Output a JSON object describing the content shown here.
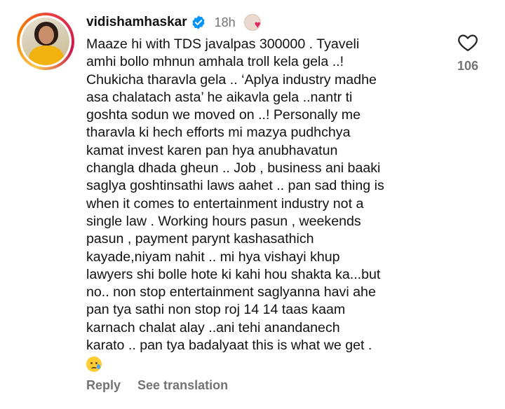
{
  "comment": {
    "username": "vidishamhaskar",
    "verified": true,
    "time": "18h",
    "lines": [
      "Maaze hi with TDS javalpas 300000 . Tyaveli",
      "amhi bollo mhnun amhala troll kela gela ..!",
      "Chukicha tharavla gela .. ‘Aplya industry madhe",
      "asa chalatach asta’ he aikavla gela ..nantr ti",
      "goshta sodun we moved on ..! Personally me",
      "tharavla ki hech efforts mi mazya pudhchya",
      "kamat invest karen pan hya anubhavatun",
      "changla dhada gheun .. Job , business ani baaki",
      "saglya goshtinsathi laws aahet .. pan sad thing is",
      "when it comes to entertainment industry not a",
      "single law . Working hours pasun , weekends",
      "pasun , payment parynt kashasathich",
      "kayade,niyam nahit .. mi hya vishayi khup",
      "lawyers shi bolle hote ki kahi hou shakta ka...but",
      "no.. non stop entertainment saglyanna havi ahe",
      "pan tya sathi non stop roj 14 14 taas kaam",
      "karnach chalat alay ..ani tehi anandanech",
      "karato .. pan tya badalyaat this is what we get ."
    ],
    "emoji": "crying-face",
    "like_count": "106",
    "reply_label": "Reply",
    "translate_label": "See translation"
  },
  "colors": {
    "verified": "#0095f6",
    "muted": "#737373",
    "heart": "#e0245e"
  }
}
